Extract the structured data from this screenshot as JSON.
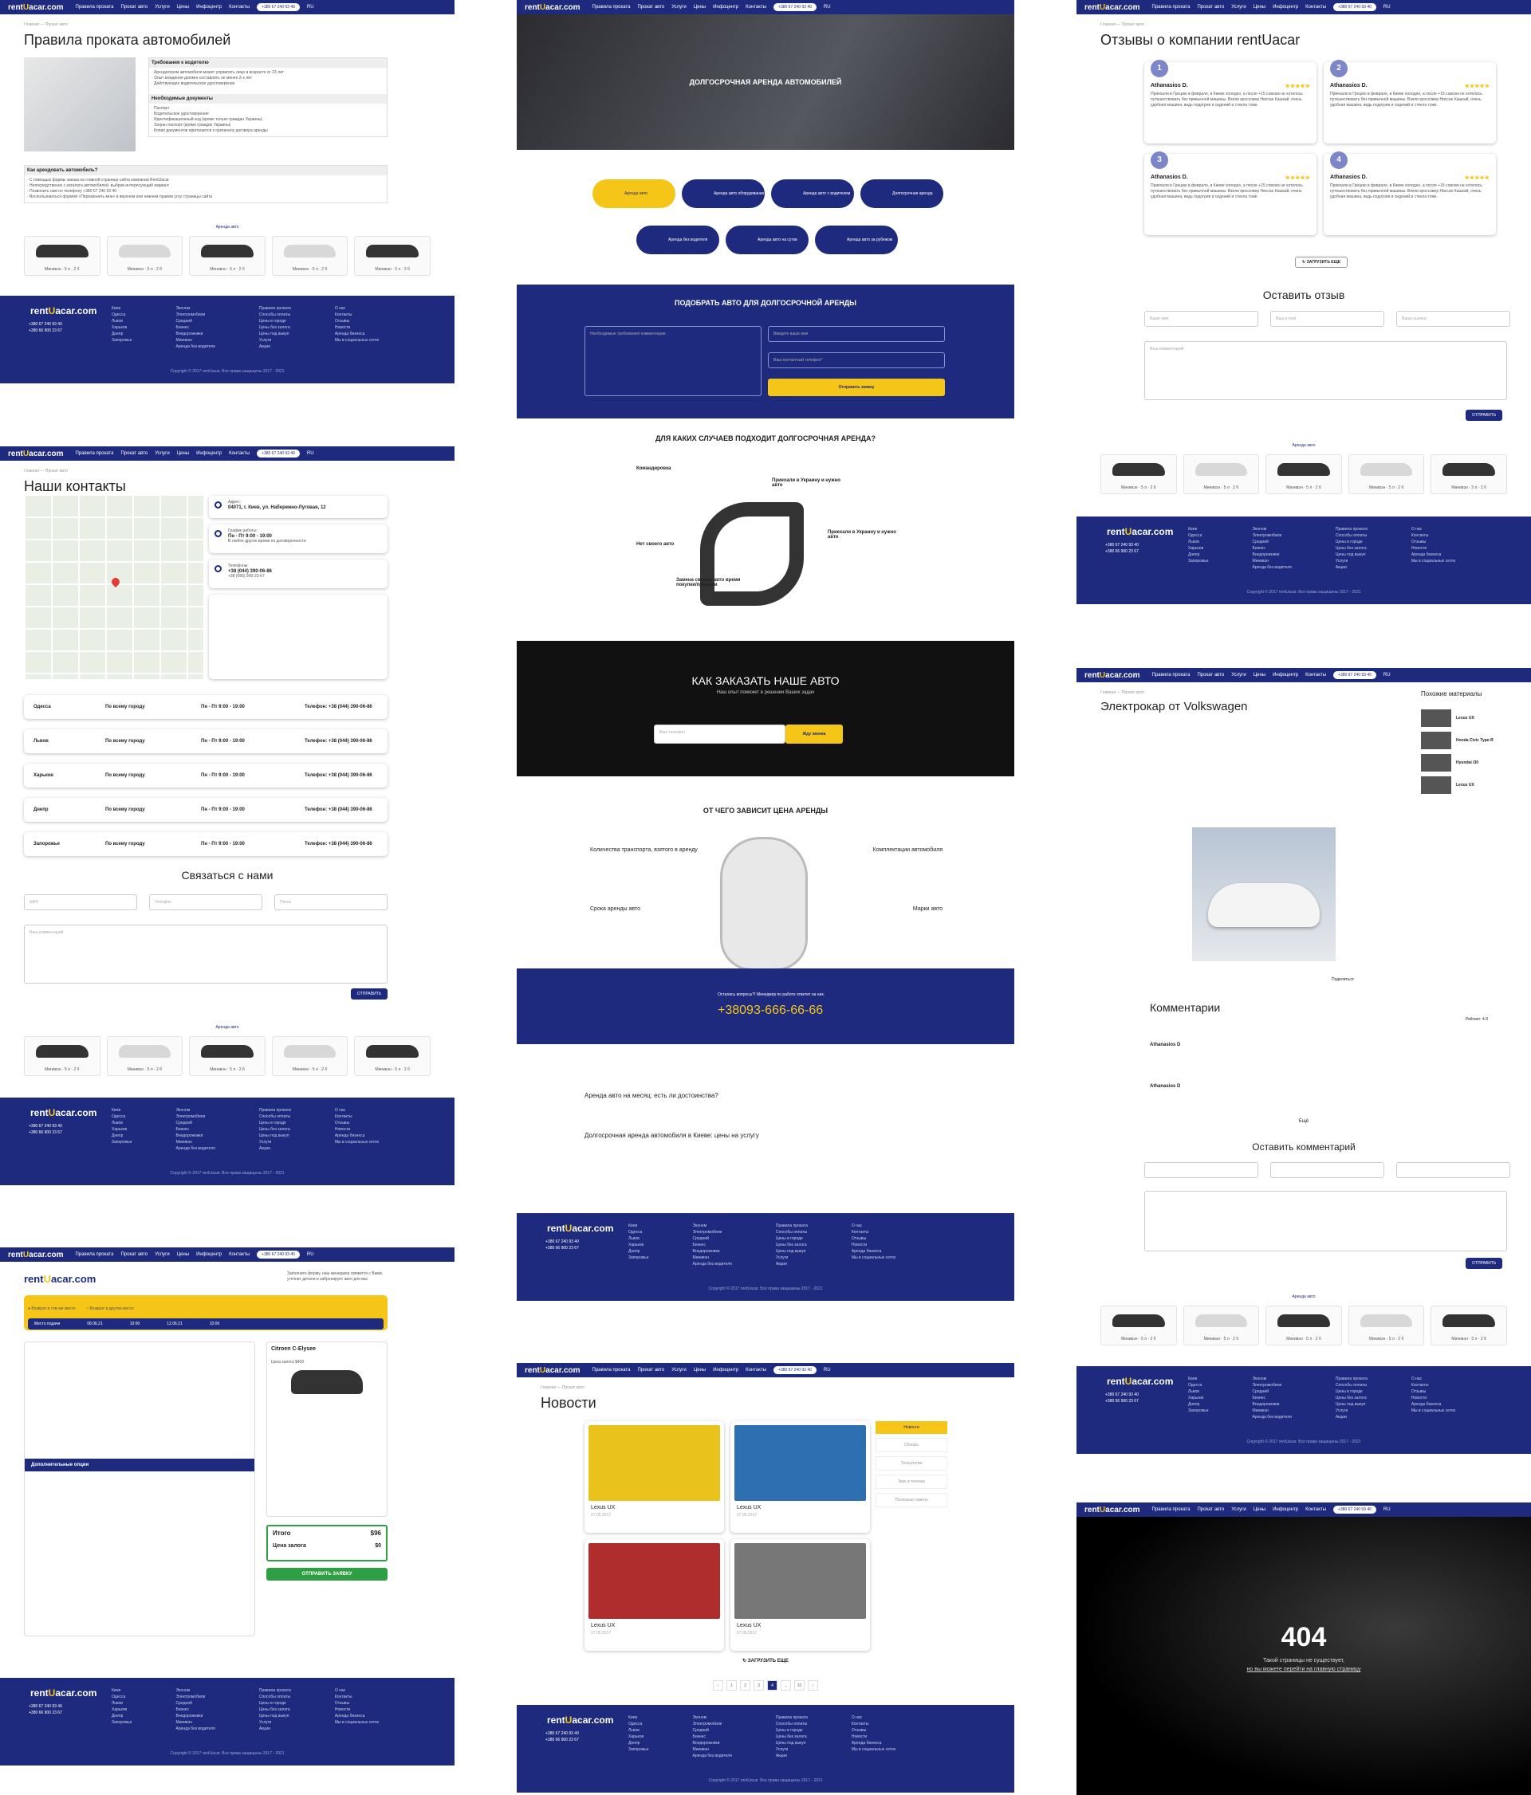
{
  "brand": {
    "logo_prefix": "rent",
    "logo_mid": "U",
    "logo_suffix": "acar.com",
    "accent": "#1e2a7d",
    "yellow": "#f5c518"
  },
  "nav": {
    "items": [
      "Правила проката",
      "Прокат авто",
      "Услуги",
      "Цены",
      "Инфоцентр",
      "Контакты"
    ],
    "phone": "+380 67 240 93 40",
    "lang": "RU"
  },
  "footer": {
    "phones": [
      "+380 67 240 93 40",
      "+380 66 900 23 67"
    ],
    "col1": [
      "Киев",
      "Одесса",
      "Львов",
      "Харьков",
      "Днепр",
      "Запорожье"
    ],
    "col2": [
      "Эконом",
      "Электромобили",
      "Средний",
      "Бизнес",
      "Внедорожники",
      "Минивэн",
      "Аренда без водителя"
    ],
    "col3": [
      "Правила проката",
      "Способы оплаты",
      "Цены в городе",
      "Цены без залога",
      "Цены под выкуп",
      "Услуги",
      "Акции"
    ],
    "col4": [
      "О нас",
      "Контакты",
      "Отзывы",
      "Новости",
      "Аренда бизнеса",
      "Мы в социальных сетях"
    ],
    "copy": "Copyright © 2017 rentUacar. Все права защищены 2017 - 2021"
  },
  "cars": {
    "label": "Аренда авто",
    "items": [
      "Минивэн · 5 л · 2 б",
      "Минивэн · 5 л · 2 б",
      "Минивэн · 5 л · 2 б",
      "Минивэн · 5 л · 2 б",
      "Минивэн · 5 л · 2 б"
    ]
  },
  "rules": {
    "breadcrumb": "Главная  —  Прокат авто",
    "title": "Правила проката автомобилей",
    "req_h": "Требования к водителю",
    "req": [
      "Арендатором автомобиля может управлять лицо в возрасте от 23 лет",
      "Опыт вождения должен составлять не менее 2-х лет",
      "Действующее водительское удостоверение"
    ],
    "doc_h": "Необходимые документы",
    "docs": [
      "Паспорт",
      "Водительское удостоверение",
      "Идентификационный код (кроме только граждан Украины)",
      "Загран паспорт (кроме граждан Украины)",
      "Копия документов прилагается к оригиналу договора аренды"
    ],
    "how_h": "Как арендовать автомобиль?",
    "how": [
      "С помощью формы заказа на главной странице сайта компании RentUacar",
      "Непосредственно с каталога автомобилей, выбрав интересующий вариант",
      "Позвонить нам по телефону +380 67 240 93 40",
      "Воспользоваться формой «Перезвонить мне» в верхнем или нижнем правом углу страницы сайта"
    ]
  },
  "contacts": {
    "title": "Наши контакты",
    "addr_h": "Адрес:",
    "addr": "04071, г. Киев, ул. Набережно-Луговая, 12",
    "hours_h": "График работы:",
    "hours": "Пн - Пт 9:00 - 19:00",
    "hours2": "В любое другое время по договоренности",
    "tel_h": "Телефоны:",
    "tels": [
      "+38 (044) 390-06-86",
      "+38 (066) 900-23-67"
    ],
    "cities": [
      {
        "c": "Одесса",
        "a": "По всему городу",
        "h": "Пн - Пт 9:00 - 19:00",
        "t": "+38 (044) 390-06-86"
      },
      {
        "c": "Львов",
        "a": "По всему городу",
        "h": "Пн - Пт 9:00 - 19:00",
        "t": "+38 (044) 390-06-86"
      },
      {
        "c": "Харьков",
        "a": "По всему городу",
        "h": "Пн - Пт 9:00 - 19:00",
        "t": "+38 (044) 390-06-86"
      },
      {
        "c": "Днепр",
        "a": "По всему городу",
        "h": "Пн - Пт 9:00 - 19:00",
        "t": "+38 (044) 390-06-86"
      },
      {
        "c": "Запорожье",
        "a": "По всему городу",
        "h": "Пн - Пт 9:00 - 19:00",
        "t": "+38 (044) 390-06-86"
      }
    ],
    "form_h": "Связаться с нами",
    "name_ph": "ФИО",
    "phone_ph": "Телефон",
    "mail_ph": "Почта",
    "comment_ph": "Ваш комментарий",
    "send": "ОТПРАВИТЬ"
  },
  "longterm": {
    "hero": "ДОЛГОСРОЧНАЯ АРЕНДА АВТОМОБИЛЕЙ",
    "pills": [
      "Аренда авто",
      "Аренда авто оборудование",
      "Аренда авто с водителем",
      "Долгосрочная аренда",
      "Аренда без водителя",
      "Аренда авто на сутки",
      "Аренда авто за рубежом"
    ],
    "pick_h": "ПОДОБРАТЬ АВТО ДЛЯ ДОЛГОСРОЧНОЙ АРЕНДЫ",
    "req_ph": "Необходимые требования/ комментарии",
    "name_ph": "Введите ваше имя",
    "tel_ph": "Ваш контактный телефон*",
    "pick_btn": "Отправить заявку",
    "cases_h": "ДЛЯ КАКИХ СЛУЧАЕВ ПОДХОДИТ ДОЛГОСРОЧНАЯ АРЕНДА?",
    "cases": [
      "Командировка",
      "Приехали в Украину и нужно авто",
      "Нет своего авто",
      "Приехали в Украину и нужно авто",
      "Замена своему авто время покупки/продажи"
    ],
    "order_h": "КАК ЗАКАЗАТЬ НАШЕ АВТО",
    "order_sub": "Наш опыт поможет в решении Ваших задач",
    "order_ph": "Ваш телефон",
    "order_btn": "Жду звонка",
    "price_h": "ОТ ЧЕГО ЗАВИСИТ ЦЕНА АРЕНДЫ",
    "factors": [
      "Количества транспорта, взятого в аренду",
      "Комплектации автомобиля",
      "Срока аренды авто",
      "Марки авто"
    ],
    "q": "Остались вопросы?! Менеджер по работе ответит на них.",
    "qphone": "+38093-666-66-66",
    "art_h1": "Аренда авто на месяц: есть ли достоинства?",
    "art_h2": "Долгосрочная аренда автомобиля в Киеве: цены на услугу"
  },
  "booking": {
    "slogan": "Заполните форму, наш менеджер свяжется с Вами, уточнит детали и забронирует авто для вас",
    "r1": "Возврат в том же месте",
    "r2": "Возврат в другом месте",
    "place": "Место подачи",
    "d1": "08.06.21",
    "t1": "10:00",
    "d2": "12.06.21",
    "t2": "10:00",
    "car": "Citroen C-Elysee",
    "price_h": "Цена залога $400",
    "extra": "Дополнительные опции",
    "total_l": "Итого",
    "total": "$96",
    "dep_l": "Цена залога",
    "dep": "$0",
    "submit": "ОТПРАВИТЬ ЗАЯВКУ"
  },
  "news": {
    "title": "Новости",
    "items": [
      {
        "t": "Lexus UX",
        "d": "07.05.2017"
      },
      {
        "t": "Lexus UX",
        "d": "07.05.2017"
      },
      {
        "t": "Lexus UX",
        "d": "07.05.2017"
      },
      {
        "t": "Lexus UX",
        "d": "07.05.2017"
      }
    ],
    "cats": [
      "Новости",
      "Обзоры",
      "Технологии",
      "Звук и техника",
      "Полезные советы"
    ],
    "more": "ЗАГРУЗИТЬ ЕЩЕ",
    "pages": [
      "‹",
      "1",
      "2",
      "3",
      "4",
      "...",
      "10",
      "›"
    ]
  },
  "reviews": {
    "title": "Отзывы о компании rentUacar",
    "items": [
      {
        "n": "1",
        "name": "Athanasios D."
      },
      {
        "n": "2",
        "name": "Athanasios D."
      },
      {
        "n": "3",
        "name": "Athanasios D."
      },
      {
        "n": "4",
        "name": "Athanasios D."
      }
    ],
    "text": "Приехали в Грецию в феврале, в Киеве холодно, а после +15 совсем не хотелось путешествовать без привычной машины. Взяли кроссовер Ниссан Кашкай, очень удобная машина, ведь подогрев и сидений и стекла тоже.",
    "more": "ЗАГРУЗИТЬ ЕЩЕ",
    "leave": "Оставить отзыв",
    "name_ph": "Ваше имя",
    "mail_ph": "Ваш e-mail",
    "rate_ph": "Ваша оценка",
    "comment_ph": "Ваш комментарий",
    "send": "ОТПРАВИТЬ"
  },
  "article": {
    "title": "Электрокар от Volkswagen",
    "similar_h": "Похожие материалы",
    "similar": [
      "Lexus UX",
      "Honda Civic Type-R",
      "Hyundai i30",
      "Lexus UX"
    ],
    "comments_h": "Комментарии",
    "rating": "Рейтинг: 4.9",
    "c1": "Athanasios D",
    "c2": "Athanasios D",
    "more": "Ещё",
    "leave": "Оставить комментарий",
    "send": "ОТПРАВИТЬ",
    "share": "Поделиться"
  },
  "e404": {
    "code": "404",
    "l1": "Такой страницы не существует,",
    "l2": "но вы можете перейти на главную страницу"
  }
}
